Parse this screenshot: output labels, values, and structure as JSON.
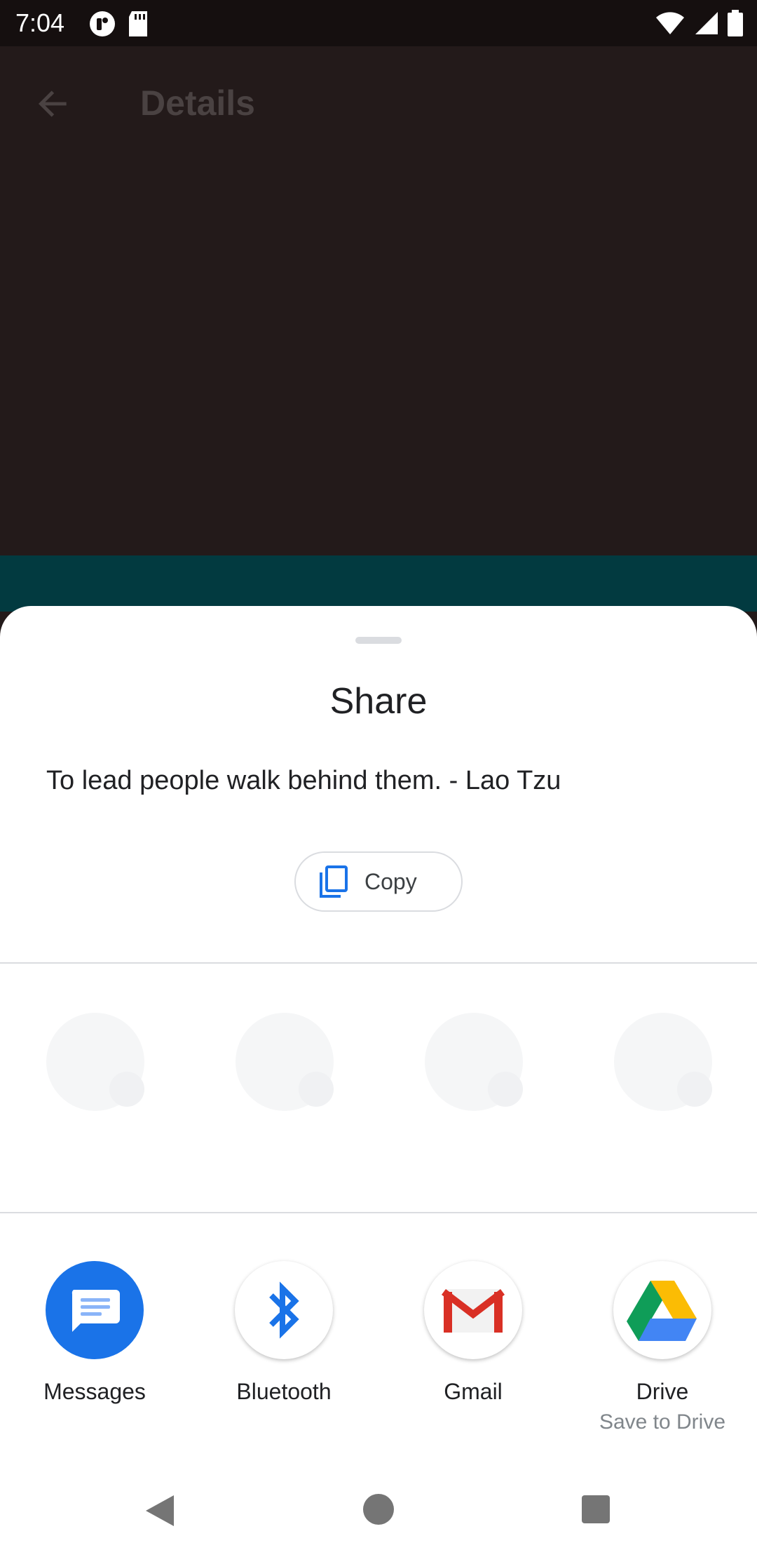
{
  "status_bar": {
    "time": "7:04"
  },
  "app_bar": {
    "title": "Details",
    "back_icon": "arrow-back-icon"
  },
  "share_sheet": {
    "title": "Share",
    "shared_text": "To lead people walk behind them. - Lao Tzu",
    "copy_label": "Copy",
    "direct_share_placeholders": 4,
    "apps": [
      {
        "label": "Messages",
        "sub_label": "",
        "icon": "messages-icon"
      },
      {
        "label": "Bluetooth",
        "sub_label": "",
        "icon": "bluetooth-icon"
      },
      {
        "label": "Gmail",
        "sub_label": "",
        "icon": "gmail-icon"
      },
      {
        "label": "Drive",
        "sub_label": "Save to Drive",
        "icon": "drive-icon"
      }
    ]
  },
  "colors": {
    "accent": "#1a73e8",
    "scrim": "#231a1a",
    "teal": "#023a40"
  }
}
